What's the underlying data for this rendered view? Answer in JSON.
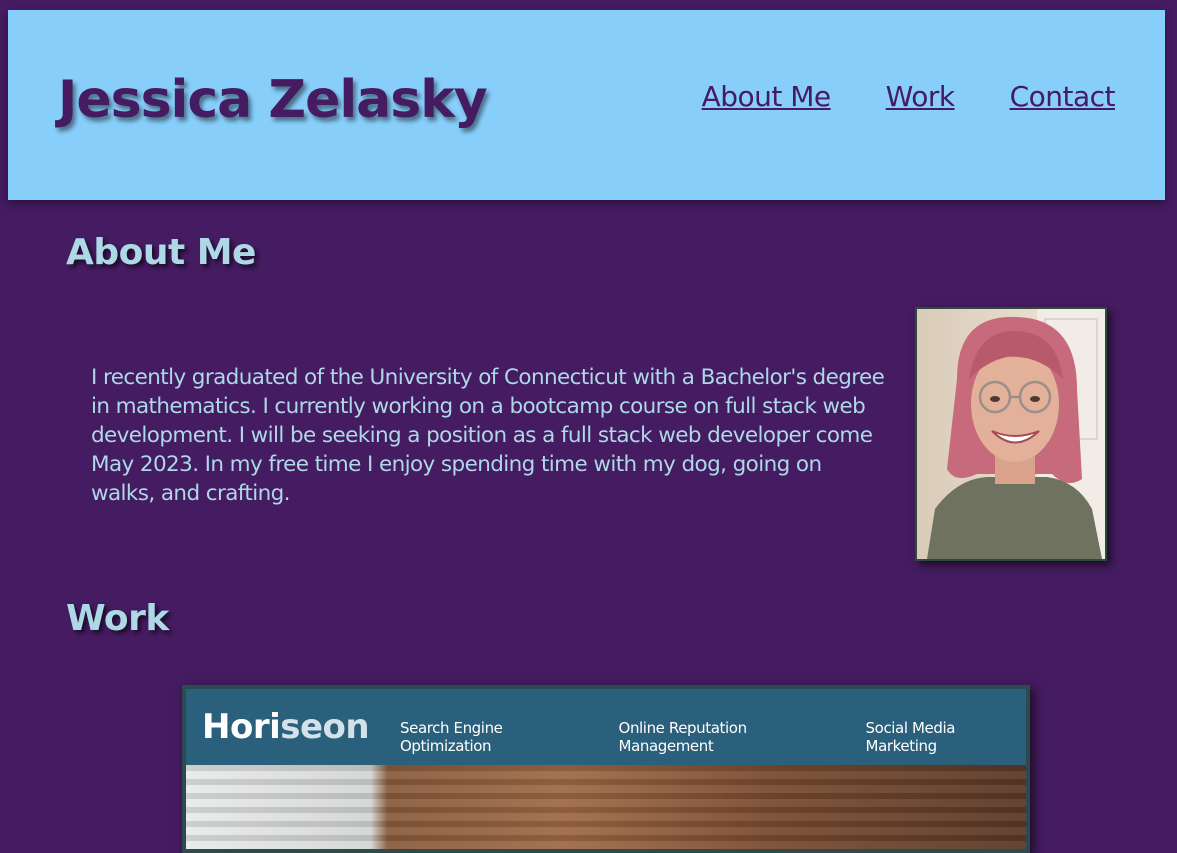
{
  "header": {
    "site_title": "Jessica Zelasky",
    "nav": [
      "About Me",
      "Work",
      "Contact"
    ]
  },
  "about": {
    "heading": "About Me",
    "text": "I recently graduated of the University of Connecticut with a Bachelor's degree in mathematics. I currently working on a bootcamp course on full stack web development. I will be seeking a position as a full stack web developer come May 2023. In my free time I enjoy spending time with my dog, going on walks, and crafting."
  },
  "work": {
    "heading": "Work",
    "project": {
      "logo_part1": "Hori",
      "logo_part2": "seon",
      "nav": [
        "Search Engine Optimization",
        "Online Reputation Management",
        "Social Media Marketing"
      ]
    }
  },
  "colors": {
    "background": "#451b61",
    "header_bg": "#87cefa",
    "accent_text": "#add8e6",
    "horiseon_bar": "#2a607c"
  }
}
